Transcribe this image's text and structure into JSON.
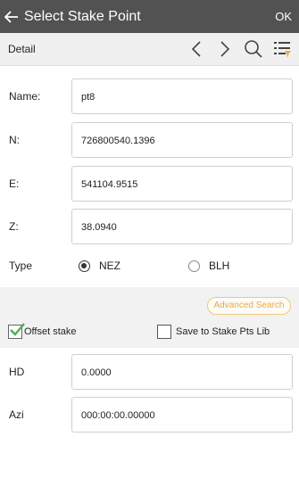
{
  "header": {
    "title": "Select Stake Point",
    "ok_label": "OK"
  },
  "toolbar": {
    "detail_label": "Detail",
    "icons": [
      "chevron-left-icon",
      "chevron-right-icon",
      "search-icon",
      "list-filter-icon"
    ]
  },
  "form": {
    "name": {
      "label": "Name:",
      "value": "pt8"
    },
    "n": {
      "label": "N:",
      "value": "726800540.1396"
    },
    "e": {
      "label": "E:",
      "value": "541104.9515"
    },
    "z": {
      "label": "Z:",
      "value": "38.0940"
    },
    "type": {
      "label": "Type",
      "options": [
        "NEZ",
        "BLH"
      ],
      "selected": "NEZ"
    }
  },
  "advanced_search_label": "Advanced Search",
  "offset_stake": {
    "label": "Offset stake",
    "checked": true
  },
  "save_to_lib": {
    "label": "Save to Stake Pts Lib",
    "checked": false
  },
  "offset": {
    "hd": {
      "label": "HD",
      "value": "0.0000"
    },
    "azi": {
      "label": "Azi",
      "value": "000:00:00.00000"
    }
  },
  "colors": {
    "appbar": "#525252",
    "accent_orange": "#f2a93b",
    "check_green": "#4caf50"
  }
}
